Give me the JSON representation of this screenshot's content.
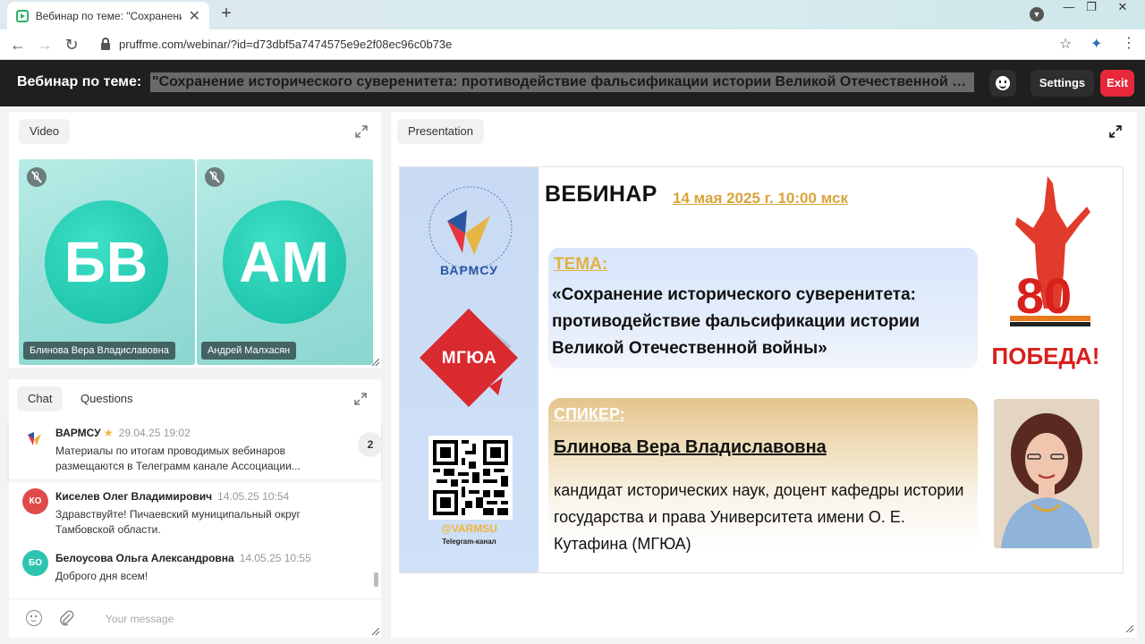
{
  "browser": {
    "tab_title": "Вебинар по теме: \"Сохранение исторического суверенитета\"",
    "tab_close": "✕",
    "new_tab": "+",
    "url": "pruffme.com/webinar/?id=d73dbf5a7474575e9e2f08ec96c0b73e",
    "window_controls": [
      "—",
      "❐",
      "✕"
    ]
  },
  "header": {
    "prefix": "Вебинар по теме:",
    "title": "\"Сохранение исторического суверенитета: противодействие фальсификации истории Великой Отечественной войны\"",
    "settings_label": "Settings",
    "exit_label": "Exit",
    "exit_color": "#e8283a"
  },
  "video_panel": {
    "label": "Video",
    "participants": [
      {
        "initials": "БВ",
        "name": "Блинова Вера Владиславовна"
      },
      {
        "initials": "АМ",
        "name": "Андрей Малхасян"
      }
    ]
  },
  "chat_panel": {
    "tabs": [
      "Chat",
      "Questions"
    ],
    "pinned": {
      "author": "ВАРМСУ",
      "time": "29.04.25 19:02",
      "text": "Материалы по итогам проводимых вебинаров размещаются в Телеграмм канале Ассоциации...",
      "count": "2"
    },
    "messages": [
      {
        "initials": "КО",
        "author": "Киселев Олег Владимирович",
        "time": "14.05.25 10:54",
        "text": "Здравствуйте! Пичаевский муниципальный округ Тамбовской области.",
        "color": "#e04a4a"
      },
      {
        "initials": "БО",
        "author": "Белоусова Ольга Александровна",
        "time": "14.05.25 10:55",
        "text": "Доброго дня всем!",
        "color": "#2fc4b0"
      }
    ],
    "input_placeholder": "Your message"
  },
  "presentation": {
    "label": "Presentation",
    "slide": {
      "heading": "ВЕБИНАР",
      "date": "14 мая 2025 г. 10:00 мск",
      "varmsu": "ВАРМСУ",
      "mgua": "МГЮА",
      "qr_handle": "@VARMSU",
      "qr_caption": "Telegram-канал",
      "topic_label": "ТЕМА:",
      "topic_text": "«Сохранение исторического суверенитета: противодействие фальсификации истории Великой Отечественной войны»",
      "speaker_label": "СПИКЕР:",
      "speaker_name": "Блинова Вера Владиславовна",
      "speaker_desc": "кандидат исторических наук, доцент кафедры истории государства и права Университета имени О. Е. Кутафина (МГЮА)",
      "victory_number": "80",
      "victory_word": "ПОБЕДА!"
    }
  }
}
